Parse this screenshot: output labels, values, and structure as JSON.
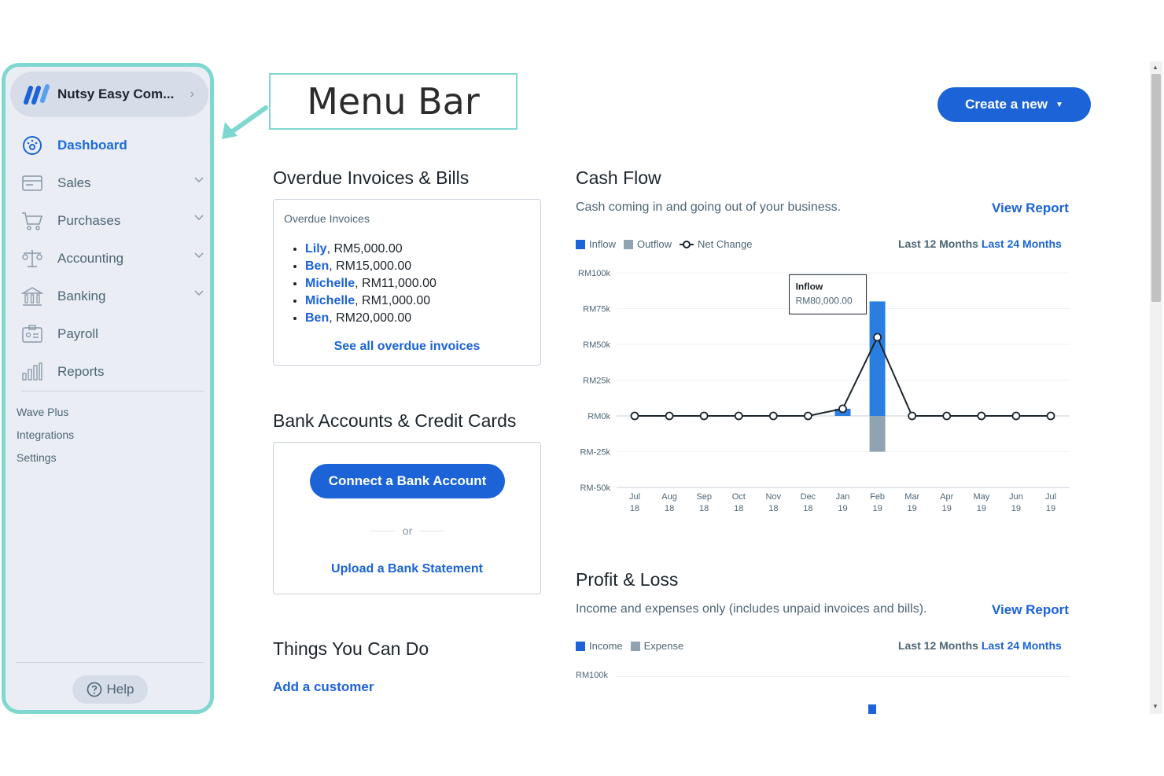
{
  "business": {
    "name": "Nutsy Easy Com..."
  },
  "nav": [
    {
      "label": "Dashboard",
      "icon": "dashboard-icon",
      "active": true
    },
    {
      "label": "Sales",
      "icon": "sales-icon"
    },
    {
      "label": "Purchases",
      "icon": "cart-icon"
    },
    {
      "label": "Accounting",
      "icon": "scale-icon"
    },
    {
      "label": "Banking",
      "icon": "bank-icon"
    },
    {
      "label": "Payroll",
      "icon": "payroll-icon"
    },
    {
      "label": "Reports",
      "icon": "bar-chart-icon"
    }
  ],
  "sublinks": [
    "Wave Plus",
    "Integrations",
    "Settings"
  ],
  "help_label": "Help",
  "annotation": "Menu Bar",
  "create_button": "Create a new",
  "overdue": {
    "title": "Overdue Invoices & Bills",
    "card_title": "Overdue Invoices",
    "items": [
      {
        "name": "Lily",
        "amount": ", RM5,000.00"
      },
      {
        "name": "Ben",
        "amount": ", RM15,000.00"
      },
      {
        "name": "Michelle",
        "amount": ", RM11,000.00"
      },
      {
        "name": "Michelle",
        "amount": ", RM1,000.00"
      },
      {
        "name": "Ben",
        "amount": ", RM20,000.00"
      }
    ],
    "see_all": "See all overdue invoices"
  },
  "bank": {
    "title": "Bank Accounts & Credit Cards",
    "connect": "Connect a Bank Account",
    "or": "or",
    "upload": "Upload a Bank Statement"
  },
  "things": {
    "title": "Things You Can Do",
    "add_customer": "Add a customer"
  },
  "cashflow": {
    "title": "Cash Flow",
    "subtitle": "Cash coming in and going out of your business.",
    "view_report": "View Report",
    "legend": [
      "Inflow",
      "Outflow",
      "Net Change"
    ],
    "period_current": "Last 12 Months",
    "period_link": "Last 24 Months",
    "tooltip_title": "Inflow",
    "tooltip_value": "RM80,000.00"
  },
  "profitloss": {
    "title": "Profit & Loss",
    "subtitle": "Income and expenses only (includes unpaid invoices and bills).",
    "view_report": "View Report",
    "legend": [
      "Income",
      "Expense"
    ],
    "period_current": "Last 12 Months",
    "period_link": "Last 24 Months",
    "y_top": "RM100k"
  },
  "colors": {
    "primary": "#1b63d6",
    "inflow": "#2a7de1",
    "outflow": "#8fa3b3",
    "sidebar_border": "#7fd8cf"
  },
  "chart_data": {
    "type": "bar",
    "x": [
      "Jul 18",
      "Aug 18",
      "Sep 18",
      "Oct 18",
      "Nov 18",
      "Dec 18",
      "Jan 19",
      "Feb 19",
      "Mar 19",
      "Apr 19",
      "May 19",
      "Jun 19",
      "Jul 19"
    ],
    "x_top": [
      "Jul",
      "Aug",
      "Sep",
      "Oct",
      "Nov",
      "Dec",
      "Jan",
      "Feb",
      "Mar",
      "Apr",
      "May",
      "Jun",
      "Jul"
    ],
    "x_bottom": [
      "18",
      "18",
      "18",
      "18",
      "18",
      "18",
      "19",
      "19",
      "19",
      "19",
      "19",
      "19",
      "19"
    ],
    "series": [
      {
        "name": "Inflow",
        "values": [
          0,
          0,
          0,
          0,
          0,
          0,
          5000,
          80000,
          0,
          0,
          0,
          0,
          0
        ]
      },
      {
        "name": "Outflow",
        "values": [
          0,
          0,
          0,
          0,
          0,
          0,
          0,
          -25000,
          0,
          0,
          0,
          0,
          0
        ]
      },
      {
        "name": "Net Change",
        "values": [
          0,
          0,
          0,
          0,
          0,
          0,
          5000,
          55000,
          0,
          0,
          0,
          0,
          0
        ]
      }
    ],
    "y_ticks": [
      "RM100k",
      "RM75k",
      "RM50k",
      "RM25k",
      "RM0k",
      "RM-25k",
      "RM-50k"
    ],
    "ylim": [
      -50000,
      100000
    ],
    "grid": true,
    "legend_position": "top-left"
  }
}
